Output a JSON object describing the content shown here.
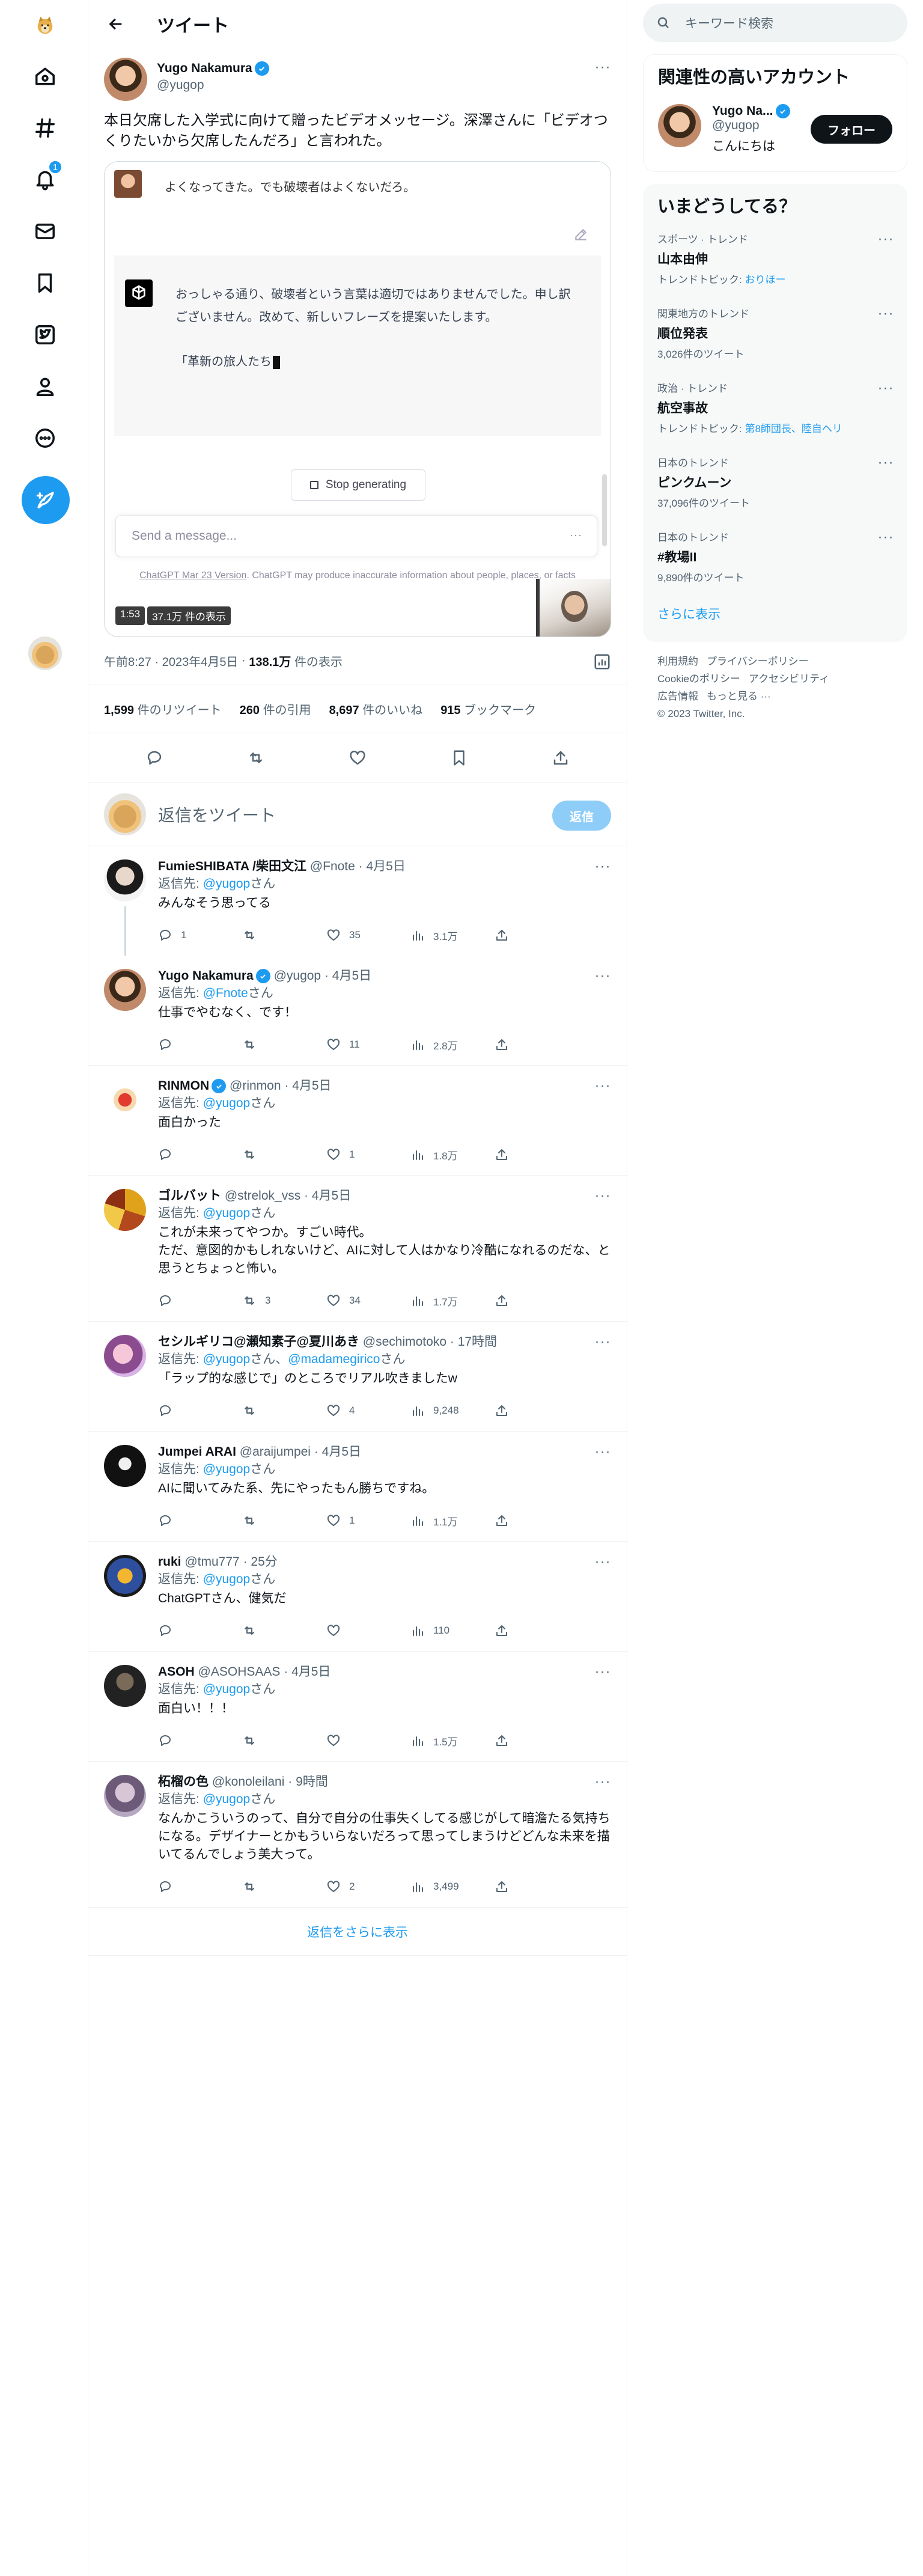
{
  "header": {
    "title": "ツイート"
  },
  "tweet": {
    "author_name": "Yugo Nakamura",
    "author_handle": "@yugop",
    "text": "本日欠席した入学式に向けて贈ったビデオメッセージ。深澤さんに「ビデオつくりたいから欠席したんだろ」と言われた。",
    "time": "午前8:27 · 2023年4月5日",
    "views_count": "138.1万",
    "views_label": "件の表示",
    "retweets_count": "1,599",
    "retweets_label": "件のリツイート",
    "quotes_count": "260",
    "quotes_label": "件の引用",
    "likes_count": "8,697",
    "likes_label": "件のいいね",
    "bookmarks_count": "915",
    "bookmarks_label": "ブックマーク"
  },
  "video": {
    "user_message": "よくなってきた。でも破壊者はよくないだろ。",
    "assistant_message": "おっしゃる通り、破壊者という言葉は適切ではありませんでした。申し訳ございません。改めて、新しいフレーズを提案いたします。",
    "assistant_phrase": "「革新の旅人たち",
    "stop_label": "Stop generating",
    "input_placeholder": "Send a message...",
    "disclaimer_link": "ChatGPT Mar 23 Version",
    "disclaimer_text": ". ChatGPT may produce inaccurate information about people, places, or facts",
    "duration": "1:53",
    "play_count": "37.1万 件の表示"
  },
  "reply_compose": {
    "placeholder": "返信をツイート",
    "button": "返信"
  },
  "replies": [
    {
      "name": "FumieSHIBATA /柴田文江",
      "handle": "@Fnote",
      "date": "4月5日",
      "to_label": "返信先: ",
      "to": "@yugop",
      "to_suffix": "さん",
      "text": "みんなそう思ってる",
      "replies": "1",
      "retweets": "",
      "likes": "35",
      "views": "3.1万"
    },
    {
      "name": "Yugo Nakamura",
      "handle": "@yugop",
      "date": "4月5日",
      "to_label": "返信先: ",
      "to": "@Fnote",
      "to_suffix": "さん",
      "text": "仕事でやむなく、です！",
      "replies": "",
      "retweets": "",
      "likes": "11",
      "views": "2.8万"
    },
    {
      "name": "RINMON",
      "handle": "@rinmon",
      "date": "4月5日",
      "to_label": "返信先: ",
      "to": "@yugop",
      "to_suffix": "さん",
      "text": "面白かった",
      "replies": "",
      "retweets": "",
      "likes": "1",
      "views": "1.8万"
    },
    {
      "name": "ゴルバット",
      "handle": "@strelok_vss",
      "date": "4月5日",
      "to_label": "返信先: ",
      "to": "@yugop",
      "to_suffix": "さん",
      "text": "これが未来ってやつか。すごい時代。\nただ、意図的かもしれないけど、AIに対して人はかなり冷酷になれるのだな、と思うとちょっと怖い。",
      "replies": "",
      "retweets": "3",
      "likes": "34",
      "views": "1.7万"
    },
    {
      "name": "セシルギリコ@瀬知素子@夏川あき",
      "handle": "@sechimotoko",
      "date": "17時間",
      "to_label": "返信先: ",
      "to": "@yugop",
      "to_mid": "さん、",
      "to2": "@madamegirico",
      "to_suffix": "さん",
      "text": "「ラップ的な感じで」のところでリアル吹きましたw",
      "replies": "",
      "retweets": "",
      "likes": "4",
      "views": "9,248"
    },
    {
      "name": "Jumpei ARAI",
      "handle": "@araijumpei",
      "date": "4月5日",
      "to_label": "返信先: ",
      "to": "@yugop",
      "to_suffix": "さん",
      "text": "AIに聞いてみた系、先にやったもん勝ちですね。",
      "replies": "",
      "retweets": "",
      "likes": "1",
      "views": "1.1万"
    },
    {
      "name": "ruki",
      "handle": "@tmu777",
      "date": "25分",
      "to_label": "返信先: ",
      "to": "@yugop",
      "to_suffix": "さん",
      "text": "ChatGPTさん、健気だ",
      "replies": "",
      "retweets": "",
      "likes": "",
      "views": "110"
    },
    {
      "name": "ASOH",
      "handle": "@ASOHSAAS",
      "date": "4月5日",
      "to_label": "返信先: ",
      "to": "@yugop",
      "to_suffix": "さん",
      "text": "面白い！！！",
      "replies": "",
      "retweets": "",
      "likes": "",
      "views": "1.5万"
    },
    {
      "name": "柘榴の色",
      "handle": "@konoleilani",
      "date": "9時間",
      "to_label": "返信先: ",
      "to": "@yugop",
      "to_suffix": "さん",
      "text": "なんかこういうのって、自分で自分の仕事失くしてる感じがして暗澹たる気持ちになる。デザイナーとかもういらないだろって思ってしまうけどどんな未来を描いてるんでしょう美大って。",
      "replies": "",
      "retweets": "",
      "likes": "2",
      "views": "3,499"
    }
  ],
  "show_more_replies": "返信をさらに表示",
  "sidebar": {
    "search_placeholder": "キーワード検索",
    "relevant_title": "関連性の高いアカウント",
    "relevant_name": "Yugo Na...",
    "relevant_handle": "@yugop",
    "relevant_bio": "こんにちは",
    "follow_label": "フォロー",
    "trends_title": "いまどうしてる？",
    "trends": [
      {
        "category": "スポーツ · トレンド",
        "title": "山本由伸",
        "sub_prefix": "トレンドトピック: ",
        "sub_link": "おりほー"
      },
      {
        "category": "関東地方のトレンド",
        "title": "順位発表",
        "sub": "3,026件のツイート"
      },
      {
        "category": "政治 · トレンド",
        "title": "航空事故",
        "sub_prefix": "トレンドトピック: ",
        "sub_link": "第8師団長、陸自ヘリ"
      },
      {
        "category": "日本のトレンド",
        "title": "ピンクムーン",
        "sub": "37,096件のツイート"
      },
      {
        "category": "日本のトレンド",
        "title": "#教場II",
        "sub": "9,890件のツイート"
      }
    ],
    "show_more": "さらに表示",
    "footer_links": [
      "利用規約",
      "プライバシーポリシー",
      "Cookieのポリシー",
      "アクセシビリティ",
      "広告情報",
      "もっと見る ···"
    ],
    "copyright": "© 2023 Twitter, Inc."
  },
  "notifications_badge": "1",
  "more_label": "···",
  "colors": {
    "accent": "#1d9bf0",
    "text": "#0f1419",
    "muted": "#536471"
  },
  "icons": {
    "nav": [
      "home-icon",
      "explore-icon",
      "notifications-icon",
      "messages-icon",
      "bookmarks-icon",
      "twitter-blue-icon",
      "profile-icon",
      "more-circle-icon",
      "compose-tweet-icon"
    ]
  }
}
